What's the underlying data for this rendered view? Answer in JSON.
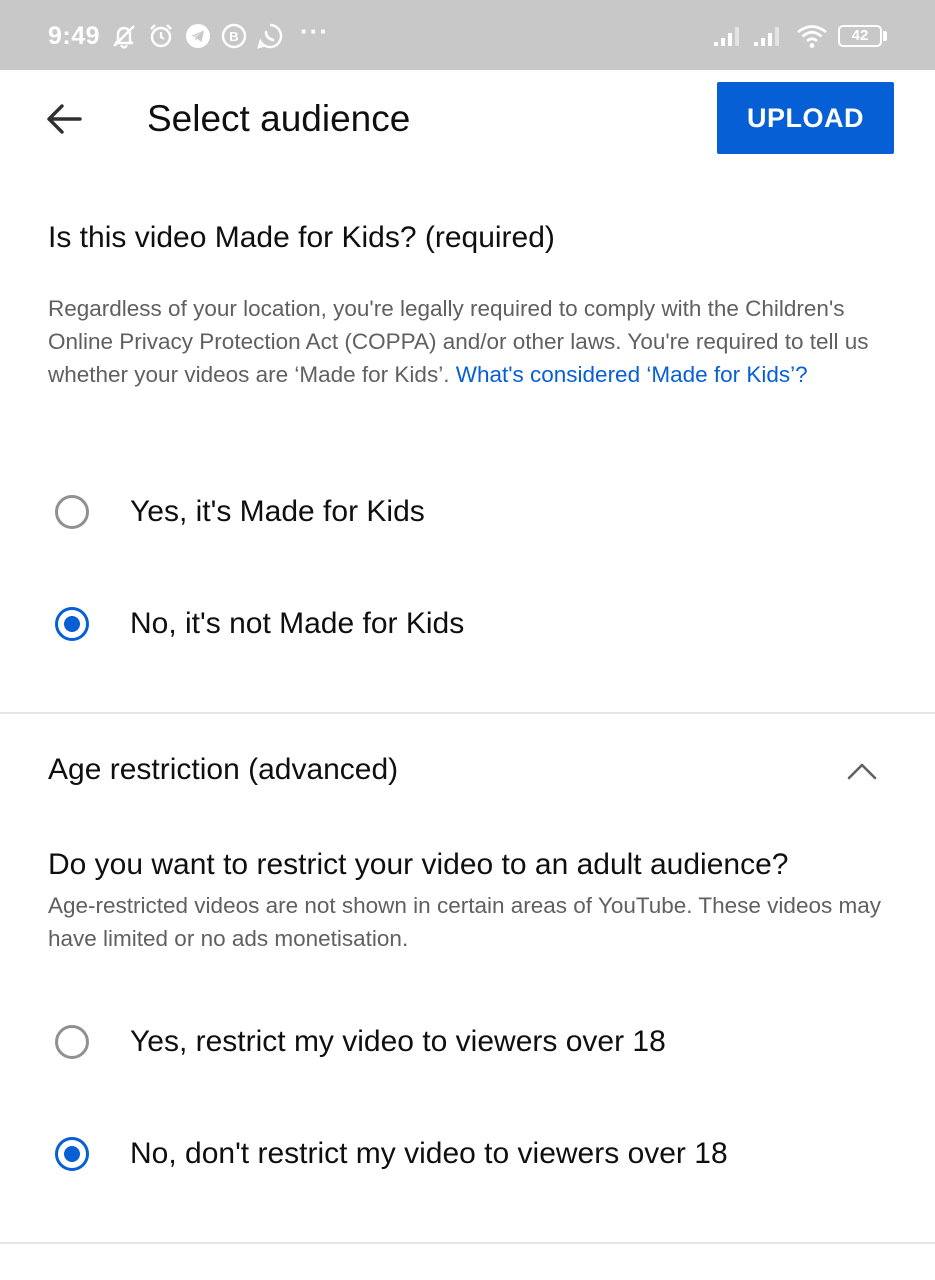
{
  "status_bar": {
    "time": "9:49",
    "battery": "42",
    "icons": [
      "muted-bell-icon",
      "alarm-icon",
      "telegram-icon",
      "b-badge-icon",
      "whatsapp-icon",
      "more-dots-icon",
      "signal-icon",
      "signal-icon",
      "wifi-icon",
      "battery-icon"
    ],
    "dots": "···"
  },
  "header": {
    "back_icon": "arrow-left-icon",
    "title": "Select audience",
    "upload_label": "UPLOAD"
  },
  "made_for_kids": {
    "heading": "Is this video Made for Kids? (required)",
    "description": "Regardless of your location, you're legally required to comply with the Children's Online Privacy Protection Act (COPPA) and/or other laws. You're required to tell us whether your videos are ‘Made for Kids’. ",
    "link_text": "What's considered ‘Made for Kids’?",
    "options": [
      {
        "label": "Yes, it's Made for Kids",
        "selected": false
      },
      {
        "label": "No, it's not Made for Kids",
        "selected": true
      }
    ]
  },
  "age_restriction": {
    "heading": "Age restriction (advanced)",
    "toggle_icon": "chevron-up-icon",
    "question": "Do you want to restrict your video to an adult audience?",
    "description": "Age-restricted videos are not shown in certain areas of YouTube. These videos may have limited or no ads monetisation.",
    "options": [
      {
        "label": "Yes, restrict my video to viewers over 18",
        "selected": false
      },
      {
        "label": "No, don't restrict my video to viewers over 18",
        "selected": true
      }
    ]
  },
  "colors": {
    "accent": "#065fd4",
    "status_bar": "#c8c8c8",
    "secondary_text": "#606060"
  }
}
